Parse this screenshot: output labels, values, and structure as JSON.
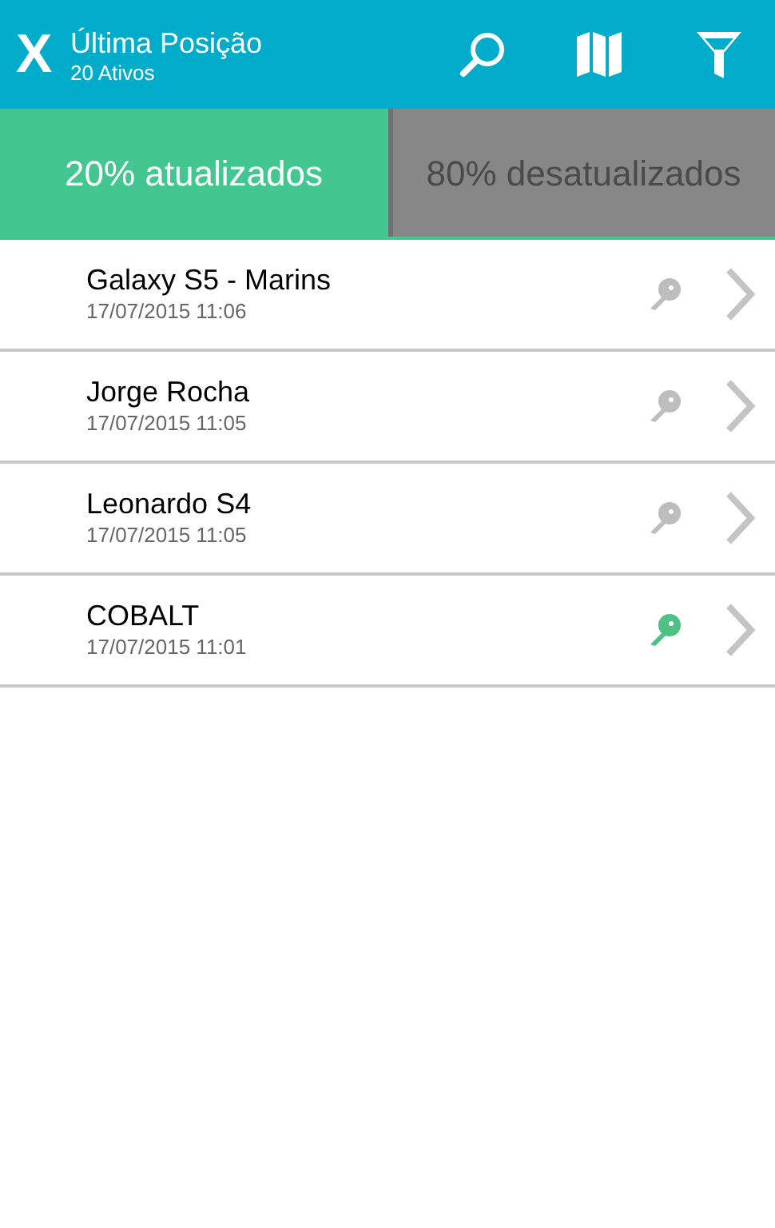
{
  "app_bar": {
    "logo": "X",
    "title": "Última Posição",
    "subtitle": "20 Ativos"
  },
  "tabs": [
    {
      "label": "20% atualizados",
      "selected": true
    },
    {
      "label": "80% desatualizados",
      "selected": false
    }
  ],
  "devices": [
    {
      "name": "Galaxy S5 - Marins",
      "time": "17/07/2015 11:06",
      "ignition_on": false
    },
    {
      "name": "Jorge Rocha",
      "time": "17/07/2015 11:05",
      "ignition_on": false
    },
    {
      "name": "Leonardo S4",
      "time": "17/07/2015 11:05",
      "ignition_on": false
    },
    {
      "name": "COBALT",
      "time": "17/07/2015 11:01",
      "ignition_on": true
    }
  ]
}
